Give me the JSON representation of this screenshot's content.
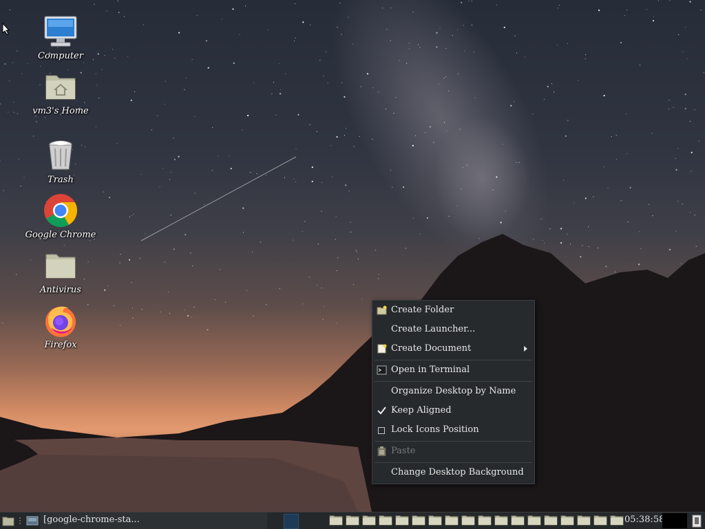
{
  "desktop": {
    "icons": [
      {
        "label": "Computer",
        "icon": "computer-icon"
      },
      {
        "label": "vm3's Home",
        "icon": "home-folder-icon"
      },
      {
        "label": "Trash",
        "icon": "trash-icon"
      },
      {
        "label": "Google Chrome",
        "icon": "chrome-icon"
      },
      {
        "label": "Antivirus",
        "icon": "folder-icon"
      },
      {
        "label": "Firefox",
        "icon": "firefox-icon"
      }
    ]
  },
  "context_menu": {
    "items": [
      {
        "label": "Create Folder",
        "icon": "folder-new-icon"
      },
      {
        "label": "Create Launcher..."
      },
      {
        "label": "Create Document",
        "icon": "document-new-icon",
        "submenu": true
      },
      {
        "label": "Open in Terminal",
        "icon": "terminal-icon"
      },
      {
        "label": "Organize Desktop by Name"
      },
      {
        "label": "Keep Aligned",
        "checked": true
      },
      {
        "label": "Lock Icons Position",
        "checked": false
      },
      {
        "label": "Paste",
        "icon": "paste-icon",
        "disabled": true
      },
      {
        "label": "Change Desktop Background"
      }
    ]
  },
  "taskbar": {
    "task_label": "[google-chrome-sta...",
    "clock": "05:38:58",
    "workspace_folder_count": 18,
    "colors": {
      "background": "#25282a",
      "active_workspace": "#1e3a57"
    }
  }
}
